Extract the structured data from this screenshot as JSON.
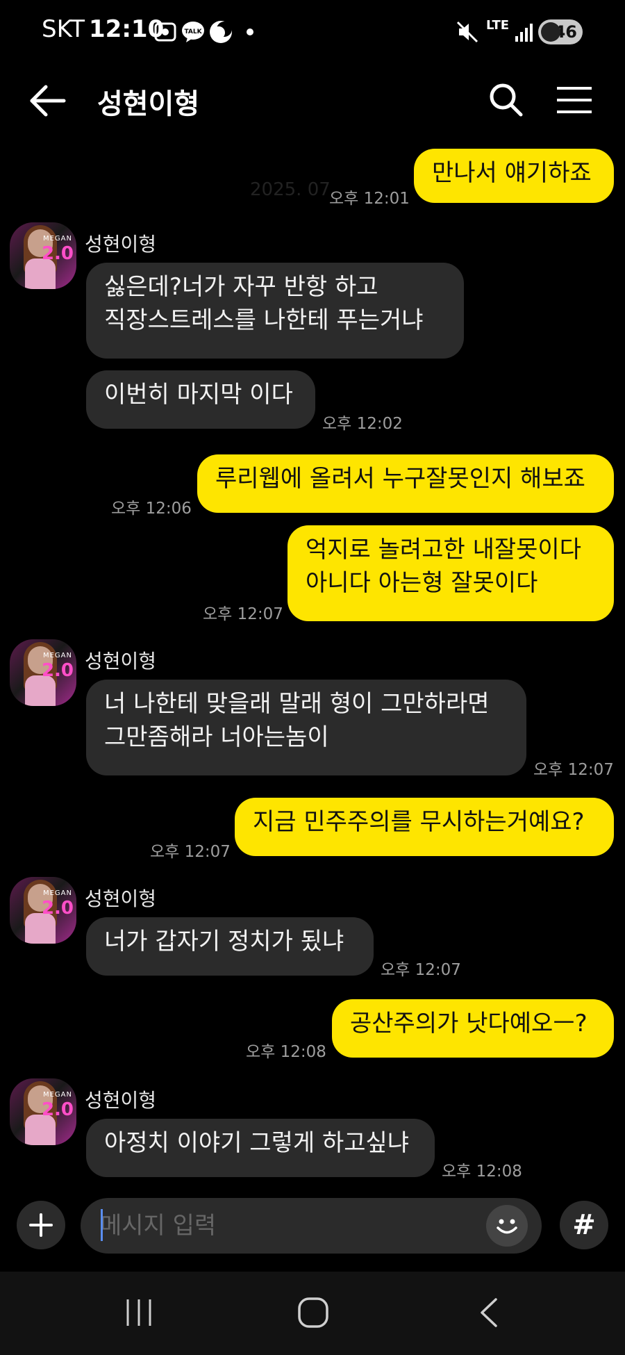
{
  "status_bar": {
    "carrier": "SKT",
    "time": "12:10",
    "talk_badge": "TALK",
    "network": "LTE",
    "battery": "46"
  },
  "header": {
    "title": "성현이형"
  },
  "date_watermark": "2025. 07.",
  "messages": [
    {
      "side": "me",
      "text": "만나서 얘기하죠",
      "time": "오후 12:01"
    },
    {
      "side": "them",
      "sender": "성현이형",
      "text": "싫은데?너가 자꾸 반항 하고\n직장스트레스를 나한테 푸는거냐",
      "time": ""
    },
    {
      "side": "them",
      "text": "이번히 마지막 이다",
      "time": "오후 12:02"
    },
    {
      "side": "me",
      "text": "루리웹에 올려서 누구잘못인지 해보죠",
      "time": "오후 12:06"
    },
    {
      "side": "me",
      "text": "억지로 놀려고한 내잘못이다\n아니다 아는형 잘못이다",
      "time": "오후 12:07"
    },
    {
      "side": "them",
      "sender": "성현이형",
      "text": "너 나한테 맞을래 말래  형이 그만하라면\n그만좀해라 너아는놈이",
      "time": "오후 12:07"
    },
    {
      "side": "me",
      "text": "지금 민주주의를 무시하는거예요?",
      "time": "오후 12:07"
    },
    {
      "side": "them",
      "sender": "성현이형",
      "text": "너가 갑자기  정치가 됬냐",
      "time": "오후 12:07"
    },
    {
      "side": "me",
      "text": "공산주의가 낫다예오ㅡ?",
      "time": "오후 12:08"
    },
    {
      "side": "them",
      "sender": "성현이형",
      "text": "아정치 이야기 그렇게 하고싶냐",
      "time": "오후 12:08"
    }
  ],
  "avatar": {
    "badge_number": "2.0",
    "badge_brand": "MEGAN"
  },
  "input": {
    "placeholder": "메시지 입력",
    "value": "",
    "hash_label": "#"
  },
  "colors": {
    "my_bubble": "#fee500",
    "their_bubble": "#2b2b2b",
    "background": "#000000"
  }
}
